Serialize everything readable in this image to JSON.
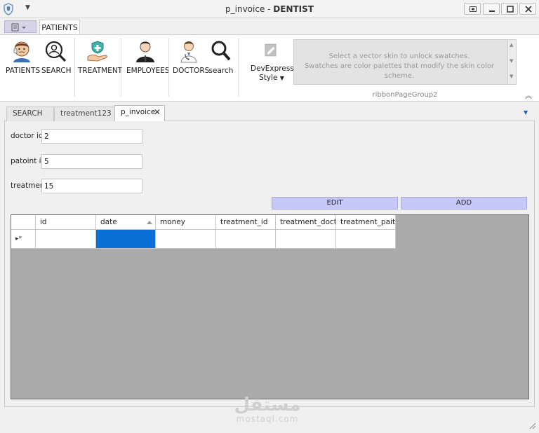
{
  "window": {
    "title_prefix": "p_invoice - ",
    "title_app": "DENTIST",
    "buttons": [
      "restore-icon",
      "minimize-icon",
      "maximize-icon",
      "close-icon"
    ]
  },
  "ribbon": {
    "tabs": [
      "PATIENTS"
    ],
    "buttons": [
      {
        "label": "PATIENTS",
        "icon": "patient-icon"
      },
      {
        "label": "SEARCH",
        "icon": "search-person-icon"
      },
      {
        "label": "TREATMENT",
        "icon": "treatment-icon"
      },
      {
        "label": "EMPLOYEES",
        "icon": "employee-icon"
      },
      {
        "label": "DOCTORS",
        "icon": "doctor-icon"
      },
      {
        "label": "search",
        "icon": "search-icon"
      },
      {
        "label": "DevExpress",
        "label2": "Style",
        "icon": "style-icon"
      }
    ],
    "gallery_text_line1": "Select a vector skin to unlock swatches.",
    "gallery_text_line2": "Swatches are color palettes that modify the skin color scheme.",
    "group_caption": "ribbonPageGroup2"
  },
  "doc_tabs": [
    "SEARCH",
    "treatment123",
    "p_invoice"
  ],
  "form": {
    "fields": [
      {
        "label": "doctor id",
        "value": "2"
      },
      {
        "label": "patoint id",
        "value": "5"
      },
      {
        "label": "treatment",
        "value": "15"
      }
    ],
    "edit_label": "EDIT",
    "add_label": "ADD"
  },
  "grid": {
    "columns": [
      "id",
      "date",
      "money",
      "treatment_id",
      "treatment_doctor_",
      "treatment_paition_"
    ],
    "sorted_column": "date",
    "new_row_indicator": "▸*"
  },
  "watermark": {
    "line1": "مستقل",
    "line2": "mostaql.com"
  },
  "colors": {
    "button_bg": "#c8c8f8",
    "selection": "#0b6fd8",
    "grid_empty": "#ababab"
  }
}
